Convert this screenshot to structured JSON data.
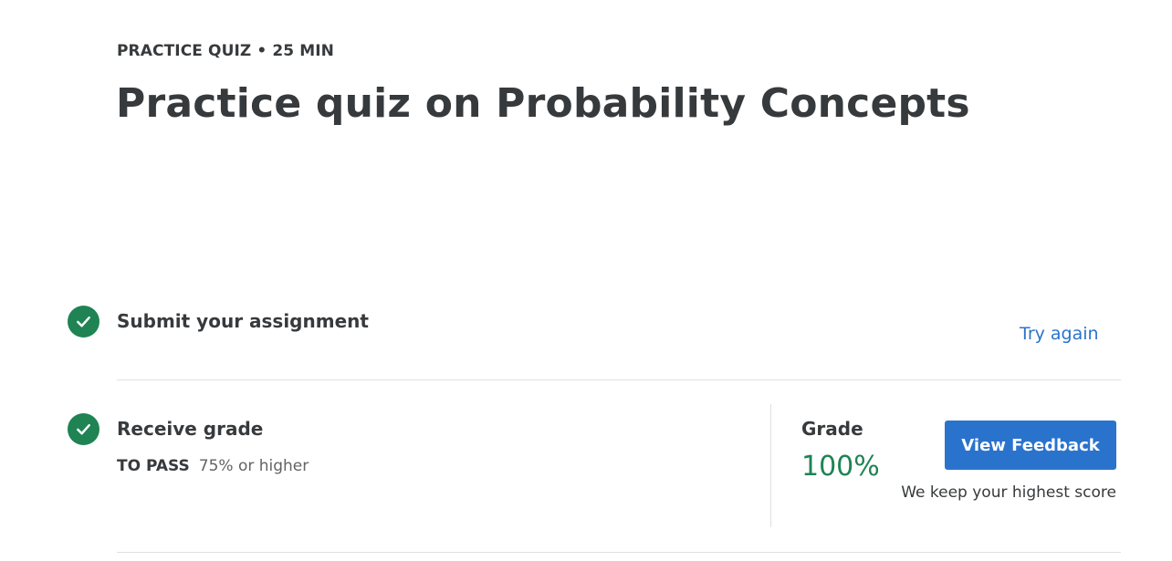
{
  "header": {
    "eyebrow": "PRACTICE QUIZ • 25 MIN",
    "title": "Practice quiz on Probability Concepts"
  },
  "steps": [
    {
      "title": "Submit your assignment",
      "status": "complete",
      "action_label": "Try again"
    },
    {
      "title": "Receive grade",
      "status": "complete",
      "pass_label": "TO PASS",
      "pass_value": "75% or higher"
    }
  ],
  "grade": {
    "label": "Grade",
    "value": "100%",
    "button_label": "View Feedback",
    "note": "We keep your highest score"
  },
  "colors": {
    "accent": "#2a73cc",
    "success": "#1f8354",
    "text": "#373a3c"
  },
  "icons": {
    "step_complete": "checkmark-circle-icon"
  }
}
